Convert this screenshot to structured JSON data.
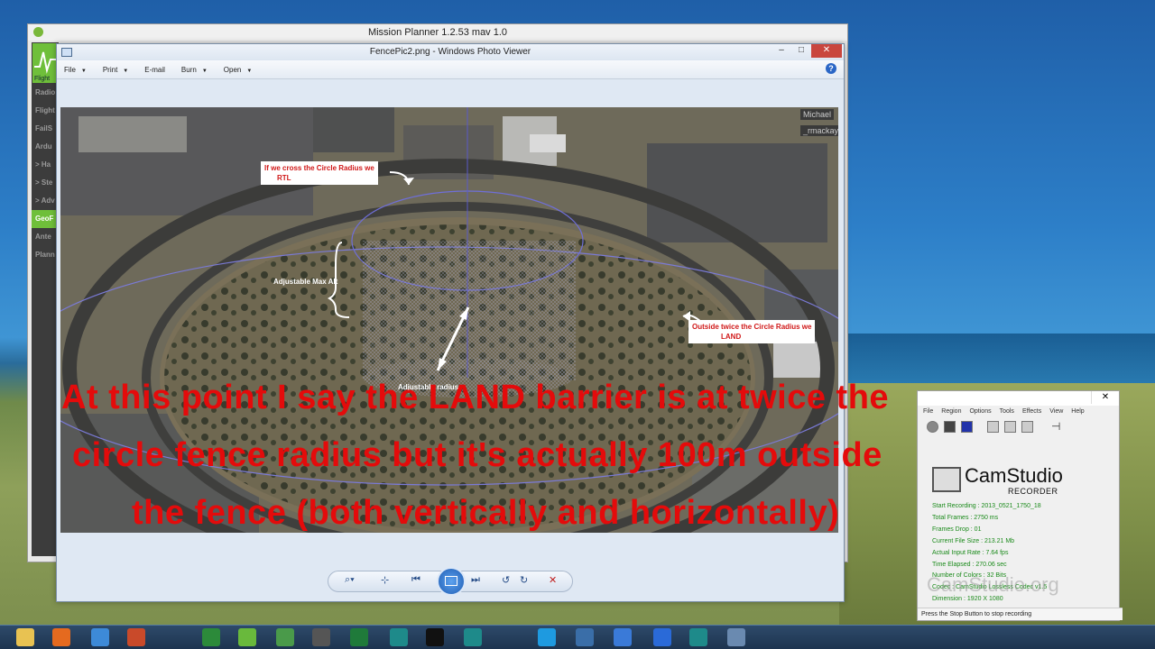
{
  "mission_planner": {
    "title": "Mission Planner 1.2.53 mav 1.0",
    "logo_label": "Flight",
    "sidebar_items": [
      "Radio",
      "Flight",
      "FailS",
      "Ardu",
      "> Ha",
      "> Ste",
      "> Adv",
      "GeoF",
      "Ante",
      "Plann"
    ],
    "active_index": 7
  },
  "photo_viewer": {
    "title": "FencePic2.png - Windows Photo Viewer",
    "menu": [
      "File",
      "Print",
      "E-mail",
      "Burn",
      "Open"
    ],
    "help_label": "?",
    "overlay_names": [
      "Michael",
      "_rmackay"
    ],
    "annotations": {
      "rtl_line1": "If we cross the Circle Radius we",
      "rtl_line2": "RTL",
      "max_alt": "Adjustable Max Alt",
      "radius": "Adjustable radius",
      "land_line1": "Outside twice the Circle Radius we",
      "land_line2": "LAND"
    }
  },
  "caption": {
    "line1": "At this point I say the LAND barrier is at twice the",
    "line2": "circle fence radius but it's actually 100m  outside",
    "line3": "the fence (both vertically and horizontally)",
    "color": "#e40b0b"
  },
  "camstudio": {
    "menu": [
      "File",
      "Region",
      "Options",
      "Tools",
      "Effects",
      "View",
      "Help"
    ],
    "app_name": "CamStudio",
    "app_sub": "RECORDER",
    "stats": [
      "Start Recording : 2013_0521_1750_18",
      "Total Frames : 2750 ms",
      "Frames Drop : 01",
      "Current File Size : 213.21 Mb",
      "Actual Input Rate : 7.64 fps",
      "Time Elapsed : 270.06 sec",
      "Number of Colors : 32 Bits",
      "Codec : CamStudio Lossless Codec v1.5",
      "Dimension : 1920 X 1080"
    ],
    "watermark": "CamStudio.org",
    "status": "Press the Stop Button to stop recording"
  },
  "taskbar": {
    "icons": [
      "explorer-icon",
      "firefox-icon",
      "app-icon",
      "media-icon",
      "xbmc-icon",
      "mission-planner-icon",
      "chart-icon",
      "mp-icon",
      "excel-icon",
      "arduino-icon",
      "cmd-icon",
      "arduino2-icon",
      "skype-icon",
      "photo-viewer-icon",
      "itunes-icon",
      "dropbox-icon",
      "arduino3-icon",
      "screen-icon"
    ]
  }
}
